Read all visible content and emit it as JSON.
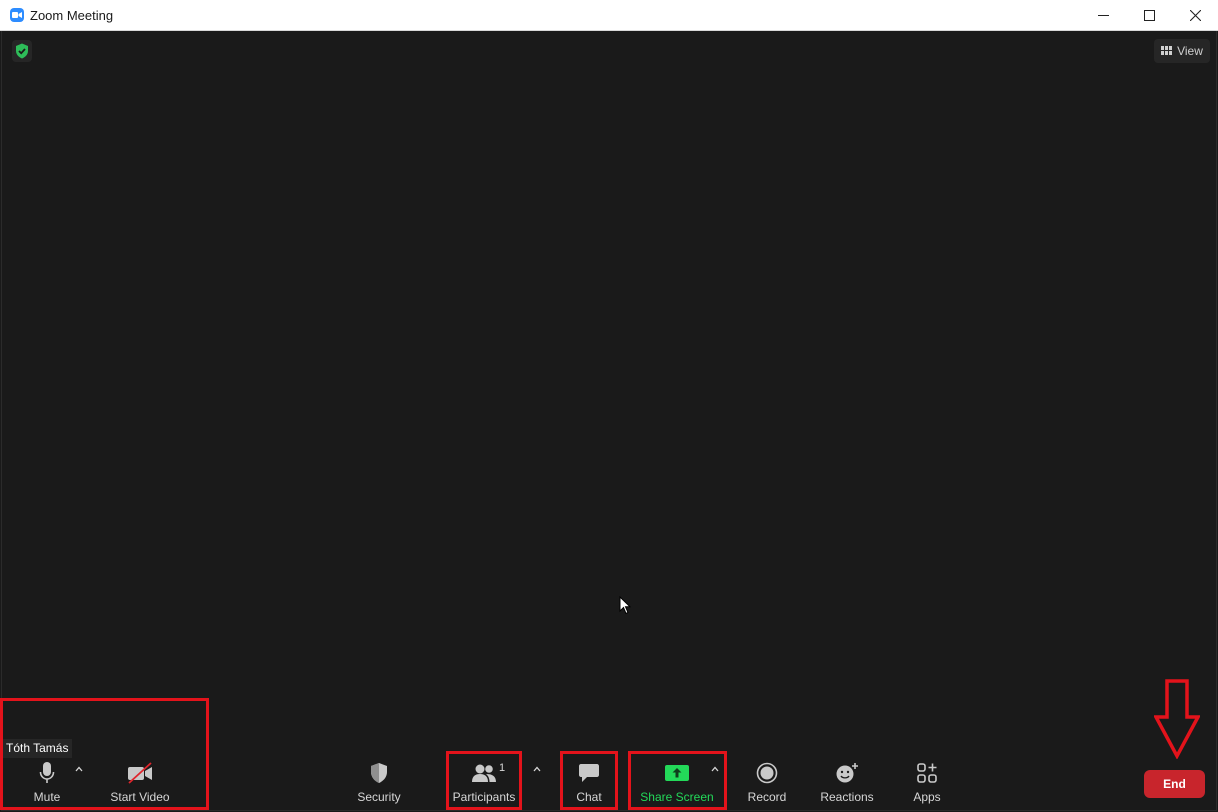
{
  "window": {
    "title": "Zoom Meeting",
    "controls": [
      "minimize-icon",
      "maximize-icon",
      "close-icon"
    ]
  },
  "header": {
    "view_label": "View",
    "security_badge_icon": "shield-check-icon"
  },
  "participant": {
    "name": "Tóth Tamás"
  },
  "toolbar": {
    "mute_label": "Mute",
    "video_label": "Start Video",
    "security_label": "Security",
    "participants_label": "Participants",
    "participants_count": "1",
    "chat_label": "Chat",
    "share_label": "Share Screen",
    "record_label": "Record",
    "reactions_label": "Reactions",
    "apps_label": "Apps",
    "end_label": "End"
  },
  "colors": {
    "background": "#1a1a1a",
    "share_green": "#23d959",
    "end_red": "#c8252c",
    "annotation_red": "#e3131b",
    "zoom_blue": "#2d8cff"
  }
}
